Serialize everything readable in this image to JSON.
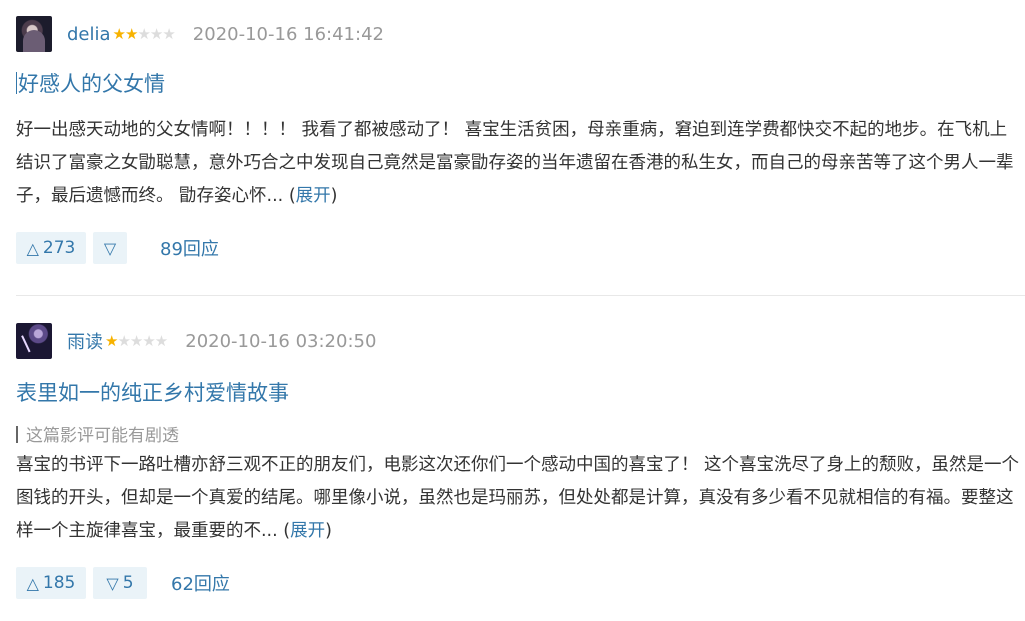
{
  "reviews": [
    {
      "author": "delia",
      "rating": 2,
      "stars_on": "★★",
      "stars_off": "★★★",
      "time": "2020-10-16 16:41:42",
      "title": "好感人的父女情",
      "body": "好一出感天动地的父女情啊！！！！ 我看了都被感动了！ 喜宝生活贫困，母亲重病，窘迫到连学费都快交不起的地步。在飞机上结识了富豪之女勖聪慧，意外巧合之中发现自己竟然是富豪勖存姿的当年遗留在香港的私生女，而自己的母亲苦等了这个男人一辈子，最后遗憾而终。 勖存姿心怀...",
      "open_paren": " (",
      "expand": "展开",
      "close_paren": ")",
      "up_icon": "△",
      "up_count": "273",
      "down_icon": "▽",
      "down_count": "",
      "replies": "89回应"
    },
    {
      "author": "雨读",
      "rating": 1,
      "stars_on": "★",
      "stars_off": "★★★★",
      "time": "2020-10-16 03:20:50",
      "title": "表里如一的纯正乡村爱情故事",
      "spoiler": "这篇影评可能有剧透",
      "body": "喜宝的书评下一路吐槽亦舒三观不正的朋友们，电影这次还你们一个感动中国的喜宝了！ 这个喜宝洗尽了身上的颓败，虽然是一个图钱的开头，但却是一个真爱的结尾。哪里像小说，虽然也是玛丽苏，但处处都是计算，真没有多少看不见就相信的有福。要整这样一个主旋律喜宝，最重要的不...",
      "open_paren": " (",
      "expand": "展开",
      "close_paren": ")",
      "up_icon": "△",
      "up_count": "185",
      "down_icon": "▽",
      "down_count": "5",
      "replies": "62回应"
    }
  ],
  "colors": {
    "link": "#3377aa",
    "star": "#f7b200",
    "meta": "#999999",
    "vote_bg": "#eaf3f8"
  }
}
